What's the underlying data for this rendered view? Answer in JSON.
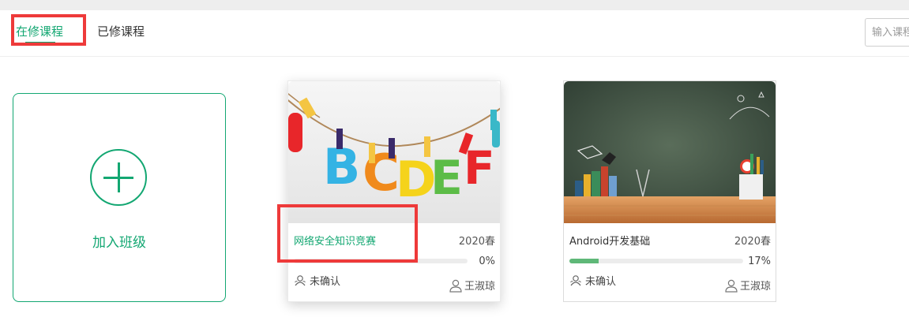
{
  "tabs": {
    "active": "在修课程",
    "done": "已修课程"
  },
  "search": {
    "placeholder": "输入课程"
  },
  "add_card": {
    "label": "加入班级"
  },
  "courses": [
    {
      "name": "网络安全知识竞赛",
      "term": "2020春",
      "progress": 0,
      "progress_text": "0%",
      "status": "未确认",
      "teacher": "王淑琼"
    },
    {
      "name": "Android开发基础",
      "term": "2020春",
      "progress": 0.17,
      "progress_text": "17%",
      "status": "未确认",
      "teacher": "王淑琼"
    }
  ],
  "colors": {
    "accent": "#13a772",
    "highlight": "#ee3a3a",
    "progress": "#5fb878"
  }
}
